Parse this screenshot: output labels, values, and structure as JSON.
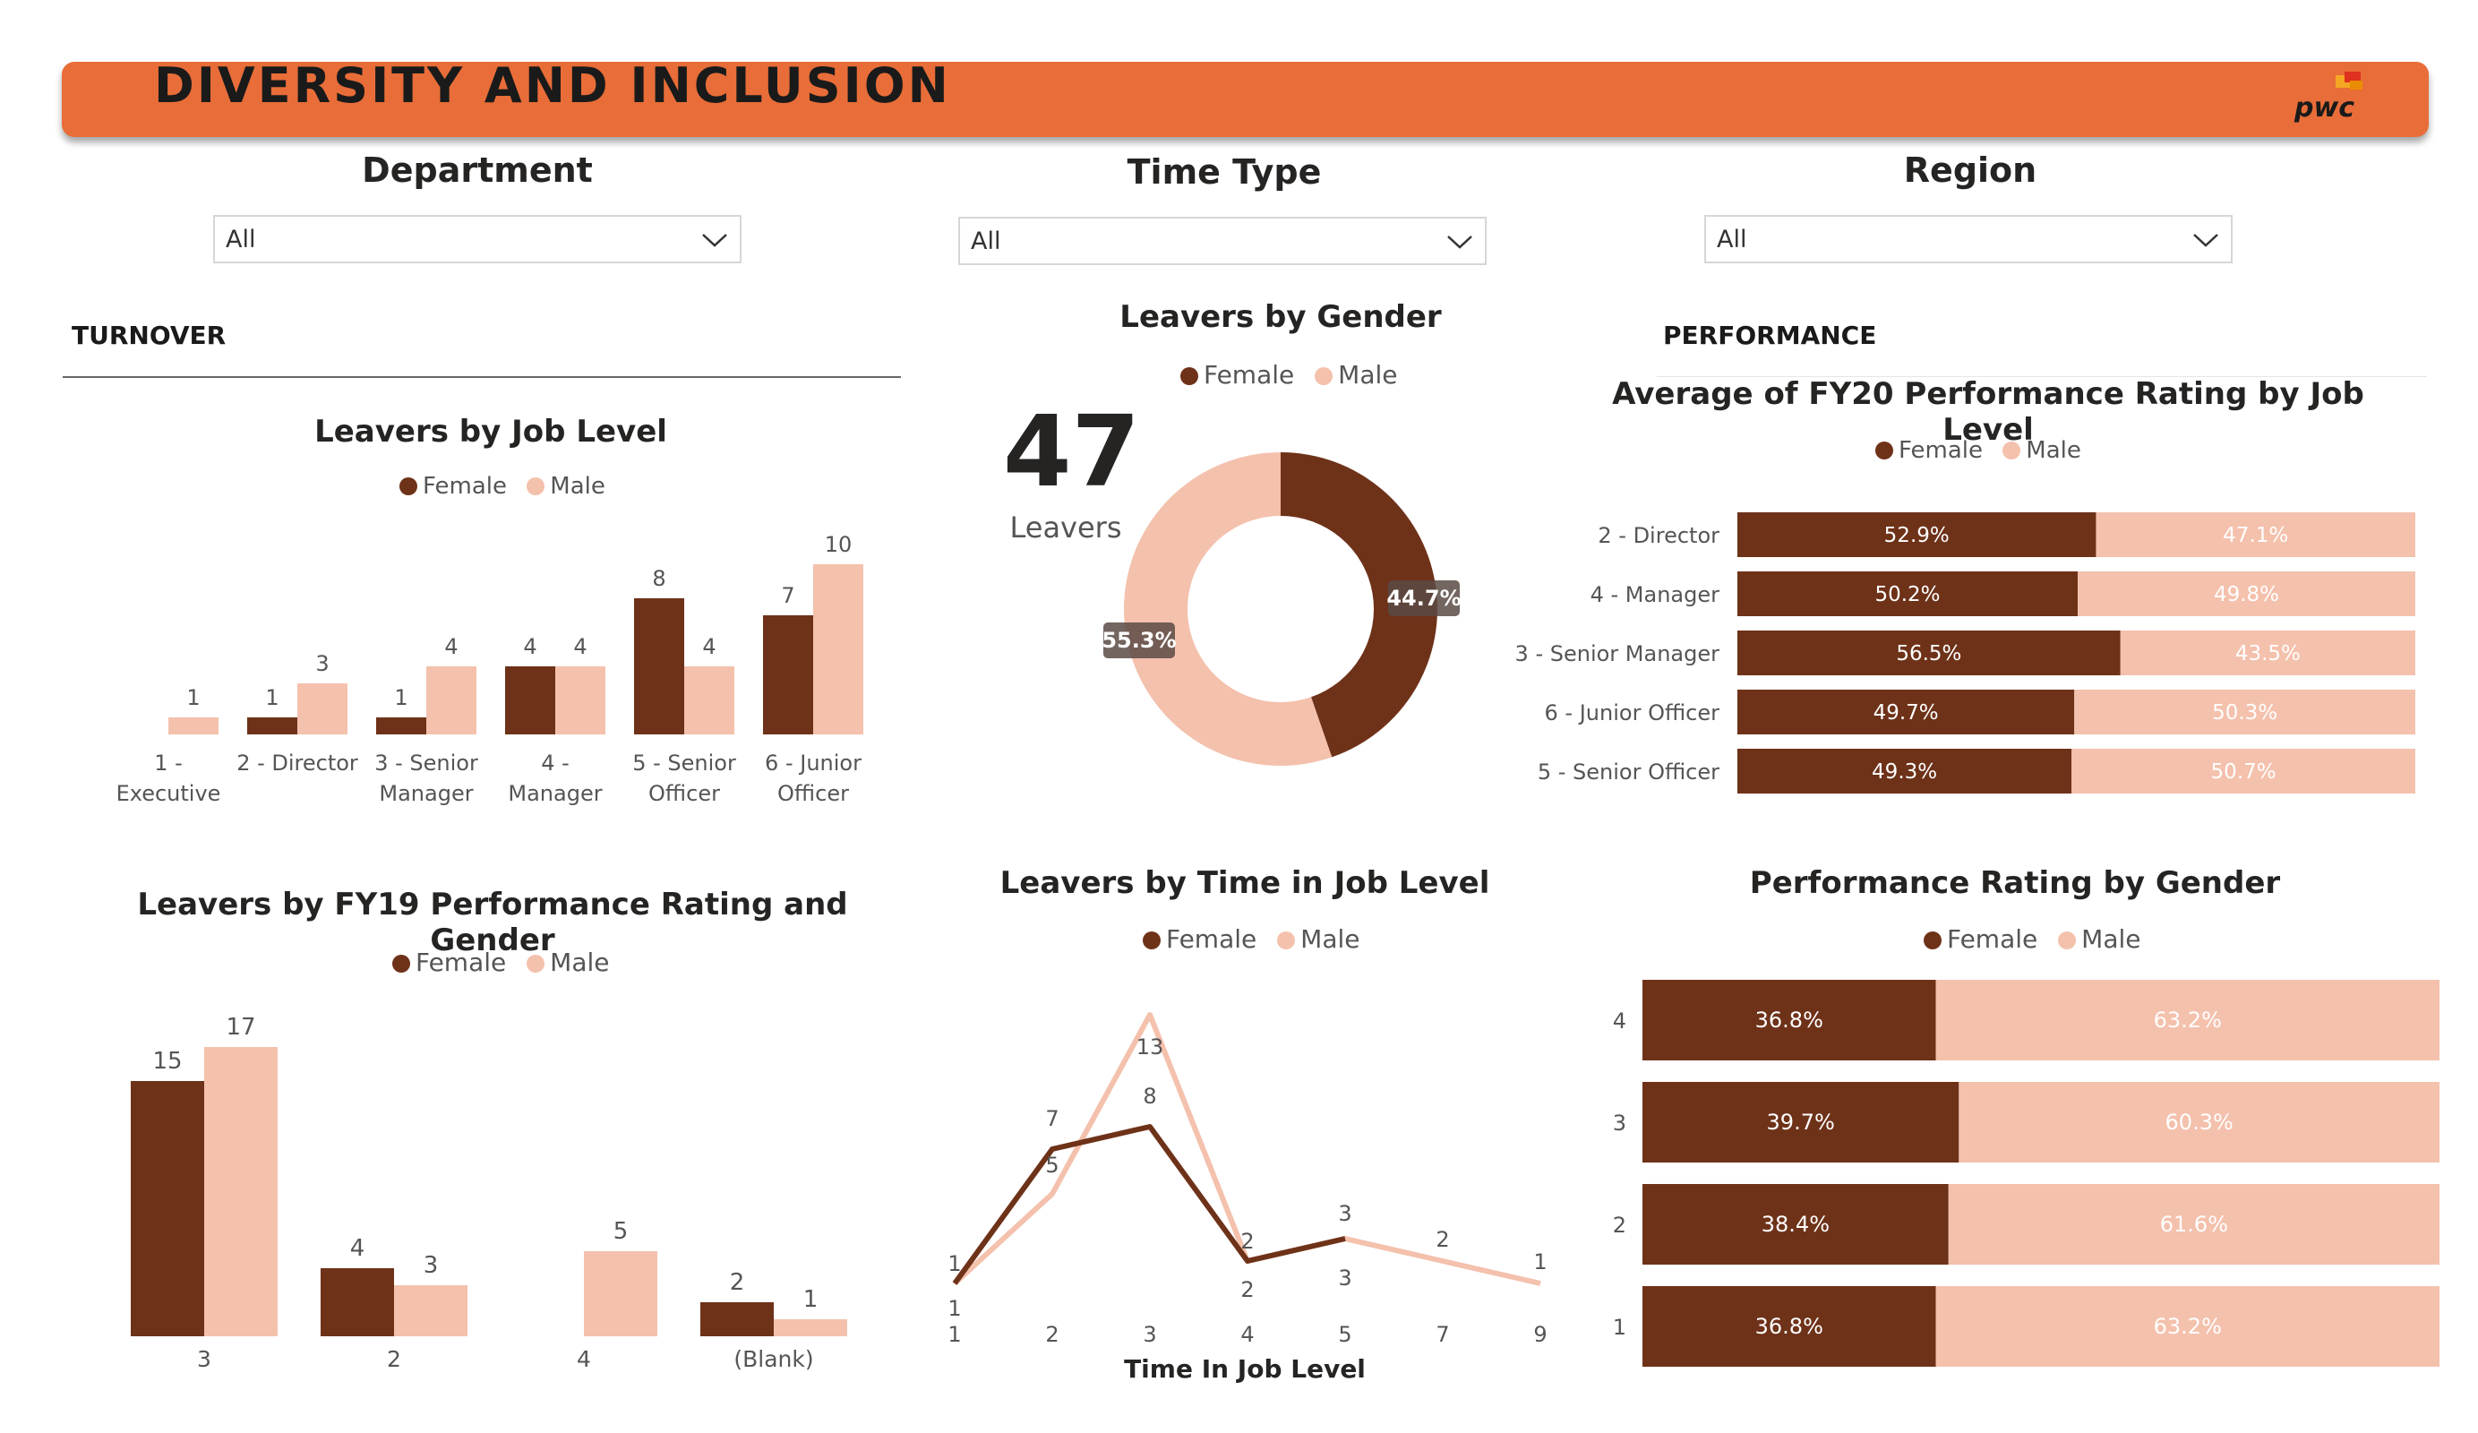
{
  "banner": {
    "title": "DIVERSITY AND INCLUSION",
    "logo_text": "pwc"
  },
  "colors": {
    "accent": "#e86d38",
    "female": "#6e3219",
    "male": "#f4c1ad"
  },
  "slicers": [
    {
      "title": "Department",
      "value": "All"
    },
    {
      "title": "Time Type",
      "value": "All"
    },
    {
      "title": "Region",
      "value": "All"
    }
  ],
  "sections": {
    "turnover": "TURNOVER",
    "performance": "PERFORMANCE"
  },
  "legend": {
    "female": "Female",
    "male": "Male"
  },
  "donut": {
    "title": "Leavers by Gender",
    "kpi_value": "47",
    "kpi_label": "Leavers",
    "female_pct_label": "44.7%",
    "male_pct_label": "55.3%"
  },
  "chart_data": [
    {
      "id": "job_level",
      "type": "bar",
      "title": "Leavers by Job Level",
      "categories": [
        "1 - Executive",
        "2 - Director",
        "3 - Senior Manager",
        "4 - Manager",
        "5 - Senior Officer",
        "6 - Junior Officer"
      ],
      "category_lines": [
        [
          "1 -",
          "Executive"
        ],
        [
          "2 - Director"
        ],
        [
          "3 - Senior",
          "Manager"
        ],
        [
          "4 -",
          "Manager"
        ],
        [
          "5 - Senior",
          "Officer"
        ],
        [
          "6 - Junior",
          "Officer"
        ]
      ],
      "series": [
        {
          "name": "Female",
          "values": [
            null,
            1,
            1,
            4,
            8,
            7
          ]
        },
        {
          "name": "Male",
          "values": [
            1,
            3,
            4,
            4,
            4,
            10
          ]
        }
      ]
    },
    {
      "id": "fy19",
      "type": "bar",
      "title": "Leavers by FY19 Performance Rating and Gender",
      "categories": [
        "3",
        "2",
        "4",
        "(Blank)"
      ],
      "series": [
        {
          "name": "Female",
          "values": [
            15,
            4,
            null,
            2
          ]
        },
        {
          "name": "Male",
          "values": [
            17,
            3,
            5,
            1
          ]
        }
      ]
    },
    {
      "id": "donut",
      "type": "pie",
      "title": "Leavers by Gender",
      "series": [
        {
          "name": "Female",
          "values": [
            44.7
          ]
        },
        {
          "name": "Male",
          "values": [
            55.3
          ]
        }
      ]
    },
    {
      "id": "time_in_level",
      "type": "line",
      "title": "Leavers by Time in Job Level",
      "xlabel": "Time In Job Level",
      "x": [
        "1",
        "2",
        "3",
        "4",
        "5",
        "7",
        "9"
      ],
      "series": [
        {
          "name": "Female",
          "values": [
            1,
            7,
            8,
            2,
            3,
            null,
            null
          ]
        },
        {
          "name": "Male",
          "values": [
            1,
            5,
            13,
            2,
            3,
            2,
            1
          ]
        }
      ]
    },
    {
      "id": "fy20",
      "type": "bar",
      "title": "Average of FY20 Performance Rating by Job Level",
      "categories": [
        "2 - Director",
        "4 - Manager",
        "3 - Senior Manager",
        "6 - Junior Officer",
        "5 - Senior Officer"
      ],
      "series": [
        {
          "name": "Female",
          "values": [
            52.9,
            50.2,
            56.5,
            49.7,
            49.3
          ],
          "labels": [
            "52.9%",
            "50.2%",
            "56.5%",
            "49.7%",
            "49.3%"
          ]
        },
        {
          "name": "Male",
          "values": [
            47.1,
            49.8,
            43.5,
            50.3,
            50.7
          ],
          "labels": [
            "47.1%",
            "49.8%",
            "43.5%",
            "50.3%",
            "50.7%"
          ]
        }
      ]
    },
    {
      "id": "perf_gender",
      "type": "bar",
      "title": "Performance Rating by Gender",
      "categories": [
        "4",
        "3",
        "2",
        "1"
      ],
      "series": [
        {
          "name": "Female",
          "values": [
            36.8,
            39.7,
            38.4,
            36.8
          ],
          "labels": [
            "36.8%",
            "39.7%",
            "38.4%",
            "36.8%"
          ]
        },
        {
          "name": "Male",
          "values": [
            63.2,
            60.3,
            61.6,
            63.2
          ],
          "labels": [
            "63.2%",
            "60.3%",
            "61.6%",
            "63.2%"
          ]
        }
      ]
    }
  ]
}
